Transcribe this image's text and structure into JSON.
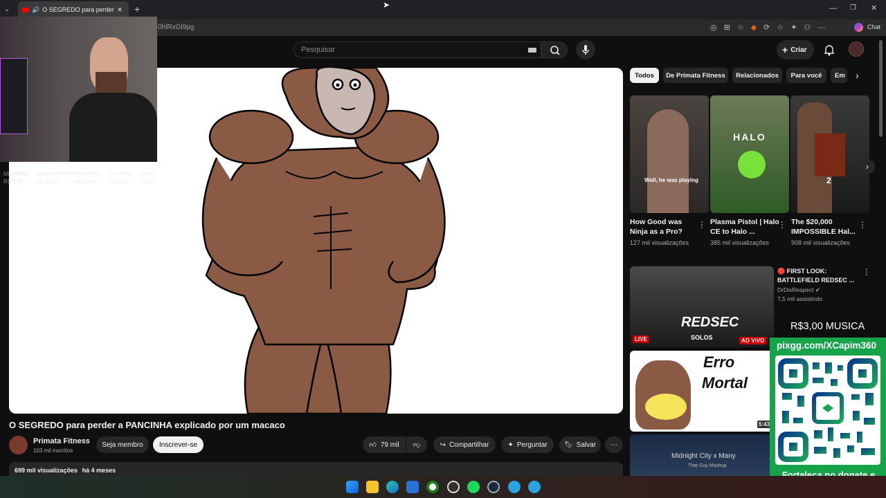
{
  "browser": {
    "tab_title": "O SEGREDO para perder a PA",
    "url": "0hlRxGl9pg",
    "chat_label": "Chat"
  },
  "header": {
    "search_placeholder": "Pesquisar",
    "create_label": "Criar"
  },
  "webcam_overlay": {
    "ghost_lines": [
      "MEMBRO",
      "R$ 2,00"
    ],
    "ghost_cols": [
      "Supporter/Promo",
      "Recebidos",
      "Recebidos",
      "Rager",
      "R$ 10,00",
      "R$ 10,00",
      "R$ 15,37",
      "R$ 20"
    ]
  },
  "video": {
    "title": "O SEGREDO para perder a PANCINHA explicado por um macaco",
    "channel": "Primata Fitness",
    "subscribers": "103 mil inscritos",
    "member_label": "Seja membro",
    "subscribe_label": "Inscrever-se",
    "likes": "79 mil",
    "share_label": "Compartilhar",
    "ask_label": "Perguntar",
    "save_label": "Salvar",
    "views": "699 mil visualizações",
    "age": "há 4 meses"
  },
  "chips": [
    "Todos",
    "De Primata Fitness",
    "Relacionados",
    "Para você",
    "Em"
  ],
  "shorts": [
    {
      "title": "How Good was Ninja as a Pro?",
      "views": "127 mil visualizações",
      "caption": "Well, he was playing"
    },
    {
      "title": "Plasma Pistol | Halo CE to Halo ...",
      "views": "385 mil visualizações",
      "caption": "HALO"
    },
    {
      "title": "The $20,000 IMPOSSIBLE Hal...",
      "views": "908 mil visualizações",
      "caption": "2"
    }
  ],
  "live_video": {
    "title": "🔴 FIRST LOOK: BATTLEFIELD REDSEC ...",
    "channel": "DrDisRespect",
    "watching": "7,5 mil assistindo",
    "badge_live": "LIVE",
    "badge_ao_vivo": "AO VIVO",
    "thumb_text": "REDSEC",
    "thumb_sub": "SOLOS"
  },
  "rec2": {
    "thumb_line1": "Erro",
    "thumb_line2": "Mortal",
    "duration": "5:43"
  },
  "rec3": {
    "thumb_line1": "Midnight City x Many",
    "thumb_line2": "That Guy Mashup"
  },
  "donate": {
    "price": "R$3,00 MUSICA",
    "link": "pixgg.com/XCapim360",
    "message": "Fortaleça no donate e envie sua mensagem!"
  }
}
